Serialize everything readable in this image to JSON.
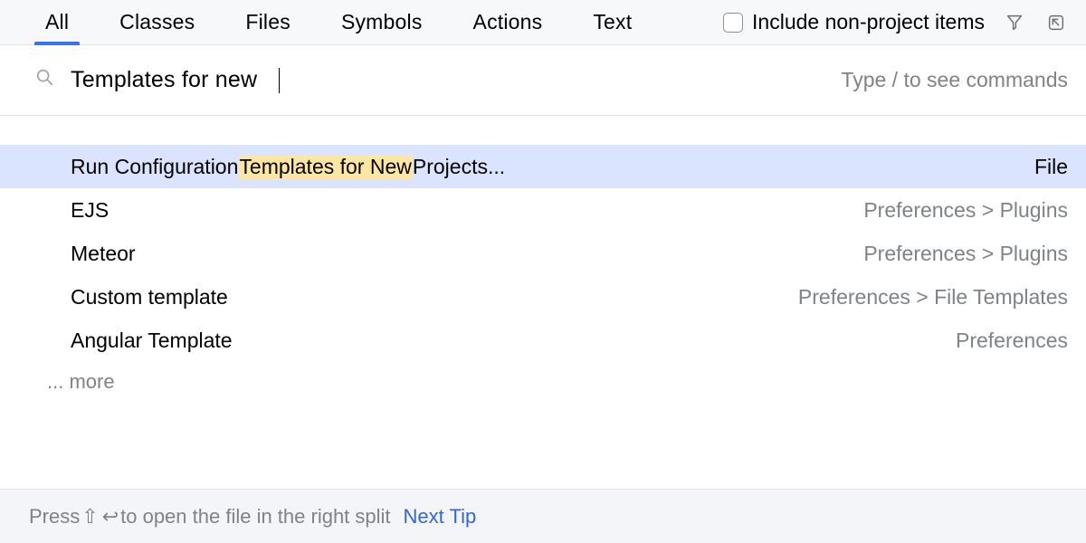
{
  "tabs": [
    "All",
    "Classes",
    "Files",
    "Symbols",
    "Actions",
    "Text"
  ],
  "active_tab_index": 0,
  "include_nonproject_label": "Include non-project items",
  "include_nonproject_checked": false,
  "search": {
    "query": "Templates for new",
    "hint": "Type / to see commands"
  },
  "results": [
    {
      "pre": "Run Configuration ",
      "match": "Templates for New",
      "post": " Projects...",
      "right": "File",
      "selected": true
    },
    {
      "pre": "EJS",
      "match": "",
      "post": "",
      "right": "Preferences > Plugins",
      "selected": false
    },
    {
      "pre": "Meteor",
      "match": "",
      "post": "",
      "right": "Preferences > Plugins",
      "selected": false
    },
    {
      "pre": "Custom template",
      "match": "",
      "post": "",
      "right": "Preferences > File Templates",
      "selected": false
    },
    {
      "pre": "Angular Template",
      "match": "",
      "post": "",
      "right": "Preferences",
      "selected": false
    }
  ],
  "more_label": "... more",
  "footer": {
    "press": "Press ",
    "shortcut_shift": "⇧",
    "shortcut_enter": "↩",
    "rest": " to open the file in the right split",
    "next_tip": "Next Tip"
  }
}
